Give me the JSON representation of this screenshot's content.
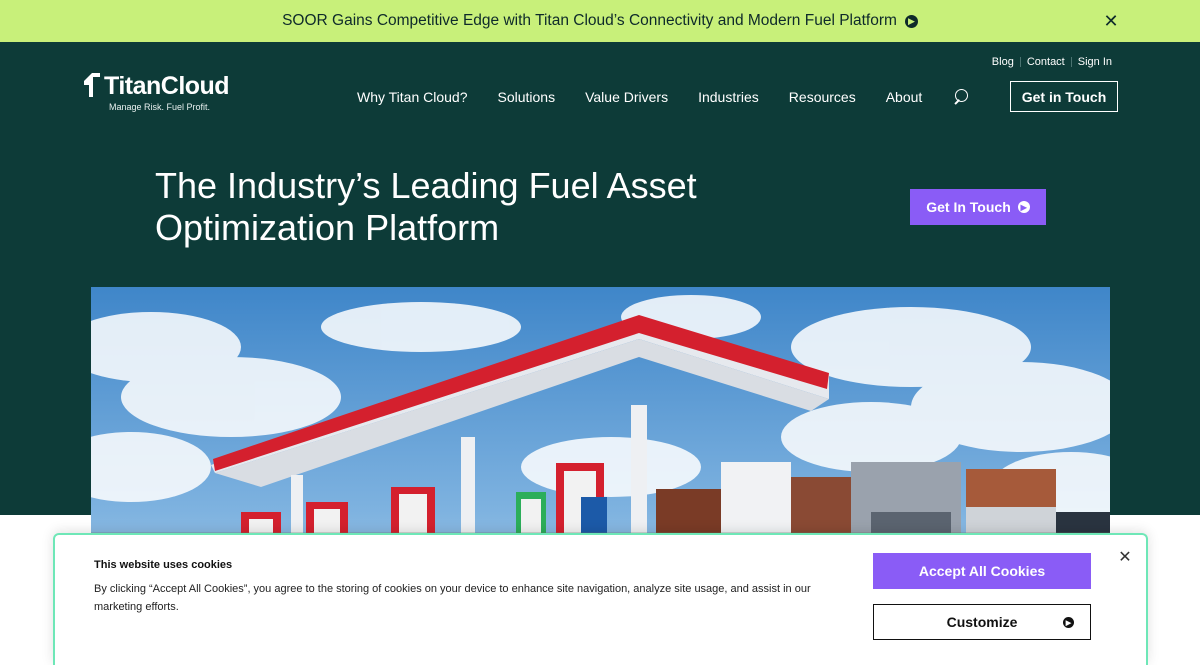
{
  "announcement": {
    "text": "SOOR Gains Competitive Edge with Titan Cloud’s Connectivity and Modern Fuel Platform",
    "arrow_icon": "arrow-right-circle-icon",
    "close_glyph": "✕"
  },
  "logo": {
    "name": "TitanCloud",
    "tagline": "Manage Risk. Fuel Profit."
  },
  "utility_nav": {
    "items": [
      "Blog",
      "Contact",
      "Sign In"
    ]
  },
  "main_nav": {
    "items": [
      "Why Titan Cloud?",
      "Solutions",
      "Value Drivers",
      "Industries",
      "Resources",
      "About"
    ],
    "search_icon": "search-icon",
    "cta_label": "Get in Touch"
  },
  "hero": {
    "title": "The Industry’s Leading Fuel Asset Optimization Platform",
    "cta_label": "Get In Touch"
  },
  "cookie_banner": {
    "title": "This website uses cookies",
    "body": "By clicking “Accept All Cookies”, you agree to the storing of cookies on your device to enhance site navigation, analyze site usage, and assist in our marketing efforts.",
    "accept_label": "Accept All Cookies",
    "customize_label": "Customize",
    "close_glyph": "✕"
  },
  "colors": {
    "announcement_bg": "#c8f07a",
    "hero_bg": "#0d3b38",
    "accent_purple": "#8a5cf6",
    "cookie_border": "#6ee7b7"
  }
}
